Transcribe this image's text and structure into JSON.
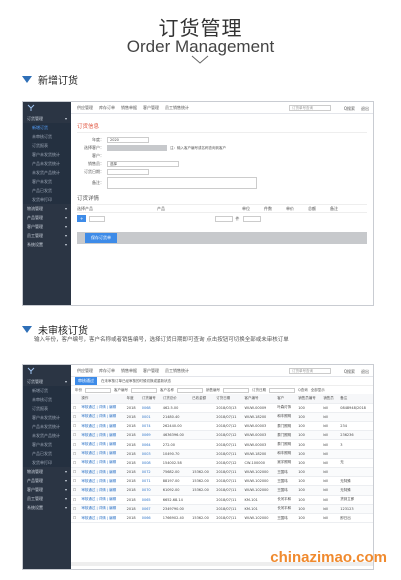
{
  "header": {
    "title_cn": "订货管理",
    "title_en": "Order Management"
  },
  "section1": {
    "label": "新增订货"
  },
  "section2": {
    "label": "未审核订货",
    "note": "输入年份，客户编号，客户名称或者销售编号，选择订货日期即可查询 点击按钮可切换全部或未审核订单"
  },
  "nav": {
    "top_items": [
      "供应管理",
      "库存订单",
      "销售单据",
      "客户管理",
      "员工销售统计"
    ],
    "search_placeholder": "订货单号查询",
    "search_btn": "Q搜索",
    "logout": "退出",
    "sidebar": [
      {
        "label": "订货管理",
        "type": "group"
      },
      {
        "label": "新增订货",
        "type": "sub",
        "active": true
      },
      {
        "label": "未审核订货",
        "type": "sub"
      },
      {
        "label": "订货报表",
        "type": "sub"
      },
      {
        "label": "客户未发货统计",
        "type": "sub"
      },
      {
        "label": "产品未发货统计",
        "type": "sub"
      },
      {
        "label": "未发货产品统计",
        "type": "sub"
      },
      {
        "label": "客户未发货",
        "type": "sub"
      },
      {
        "label": "产品已发货",
        "type": "sub"
      },
      {
        "label": "发货单打印",
        "type": "sub"
      },
      {
        "label": "物流管理",
        "type": "group"
      },
      {
        "label": "产品管理",
        "type": "group"
      },
      {
        "label": "客户管理",
        "type": "group"
      },
      {
        "label": "员工管理",
        "type": "group"
      },
      {
        "label": "系统设置",
        "type": "group"
      }
    ]
  },
  "form": {
    "title": "订货信息",
    "year_label": "年度：",
    "year_value": "2020",
    "customer_label": "选择客户：",
    "customer_hint": "注：输入客户编号或名称查询到客户",
    "customer2_label": "客户：",
    "sales_label": "销售员：",
    "sales_value": "选择",
    "date_label": "订货日期：",
    "remark_label": "备注：",
    "detail_title": "订货详情",
    "cols": [
      "选择产品",
      "产品",
      "单位",
      "件数",
      "单价",
      "总额",
      "备注"
    ],
    "unit_value": "件",
    "add_btn": "+",
    "save_btn": "保存订货单"
  },
  "list": {
    "toolbar": [
      "审核通过",
      "在未审核订单已经审核的时候切换或重新状态"
    ],
    "filters": [
      "年份",
      "客户编号",
      "客户名称",
      "销售编号",
      "订货日期",
      "Q查询",
      "全部显示"
    ],
    "headers": [
      "",
      "操作",
      "年度",
      "订货编号",
      "订货总价",
      "已收金额",
      "订货日期",
      "客户编号",
      "客户",
      "销售员编号",
      "销售员",
      "备注"
    ],
    "rows": [
      [
        "审核通过 | 详情 | 编辑",
        "2018",
        "0068",
        "462.5.00",
        "",
        "2018/03/13",
        "WUW-00009",
        "叶森灯饰",
        "100",
        "kill",
        "0848948/2018"
      ],
      [
        "审核通过 | 详情 | 编辑",
        "2018",
        "0001",
        "21480.40",
        "",
        "2018/07/11",
        "WUW-18200",
        "和丰照明",
        "100",
        "kill",
        ""
      ],
      [
        "审核通过 | 详情 | 编辑",
        "2018",
        "0074",
        "262440.00",
        "",
        "2018/07/12",
        "WUW-00003",
        "泰门照明",
        "100",
        "kill",
        "234"
      ],
      [
        "审核通过 | 详情 | 编辑",
        "2018",
        "0069",
        "4636396.00",
        "",
        "2018/07/12",
        "WUW-00003",
        "泰门照明",
        "100",
        "kill",
        "236236"
      ],
      [
        "审核通过 | 详情 | 编辑",
        "2018",
        "0064",
        "272.00",
        "",
        "2018/07/11",
        "WUW-00003",
        "泰门照明",
        "100",
        "kill",
        "3"
      ],
      [
        "审核通过 | 详情 | 编辑",
        "2018",
        "0003",
        "10490.70",
        "",
        "2018/07/11",
        "WUW-18200",
        "和丰照明",
        "100",
        "kill",
        ""
      ],
      [
        "审核通过 | 详情 | 编辑",
        "2018",
        "0008",
        "154002.58",
        "",
        "2018/07/12",
        "CW-100000",
        "吴宇照明",
        "100",
        "kill",
        "无"
      ],
      [
        "审核通过 | 详情 | 编辑",
        "2018",
        "0072",
        "75682.00",
        "15362.00",
        "2018/07/11",
        "WUW-102000",
        "王国玮",
        "100",
        "kill",
        ""
      ],
      [
        "审核通过 | 详情 | 编辑",
        "2018",
        "0071",
        "88197.00",
        "15362.00",
        "2018/07/11",
        "WUW-102000",
        "王国玮",
        "100",
        "kill",
        "无特殊"
      ],
      [
        "审核通过 | 详情 | 编辑",
        "2018",
        "0070",
        "61092.00",
        "15362.00",
        "2018/07/11",
        "WUW-102000",
        "王国玮",
        "100",
        "kill",
        "无特殊"
      ],
      [
        "审核通过 | 详情 | 编辑",
        "2018",
        "0065",
        "6652.68.14",
        "",
        "2018/07/11",
        "KM-101",
        "长河平和",
        "100",
        "kill",
        "货到立即"
      ],
      [
        "审核通过 | 详情 | 编辑",
        "2018",
        "0067",
        "2349790.00",
        "",
        "2018/07/11",
        "KM-101",
        "长河平和",
        "100",
        "kill",
        "123123"
      ],
      [
        "审核通过 | 详情 | 编辑",
        "2018",
        "0066",
        "1766902.40",
        "15362.00",
        "2018/07/11",
        "WUW-102000",
        "王国玮",
        "100",
        "kill",
        "即日出"
      ]
    ]
  },
  "watermark": "chinazimao.com",
  "colors": {
    "accent": "#2e6fb7",
    "sidebar": "#2b3544",
    "link": "#2f74c7",
    "form_title": "#e0533d"
  }
}
